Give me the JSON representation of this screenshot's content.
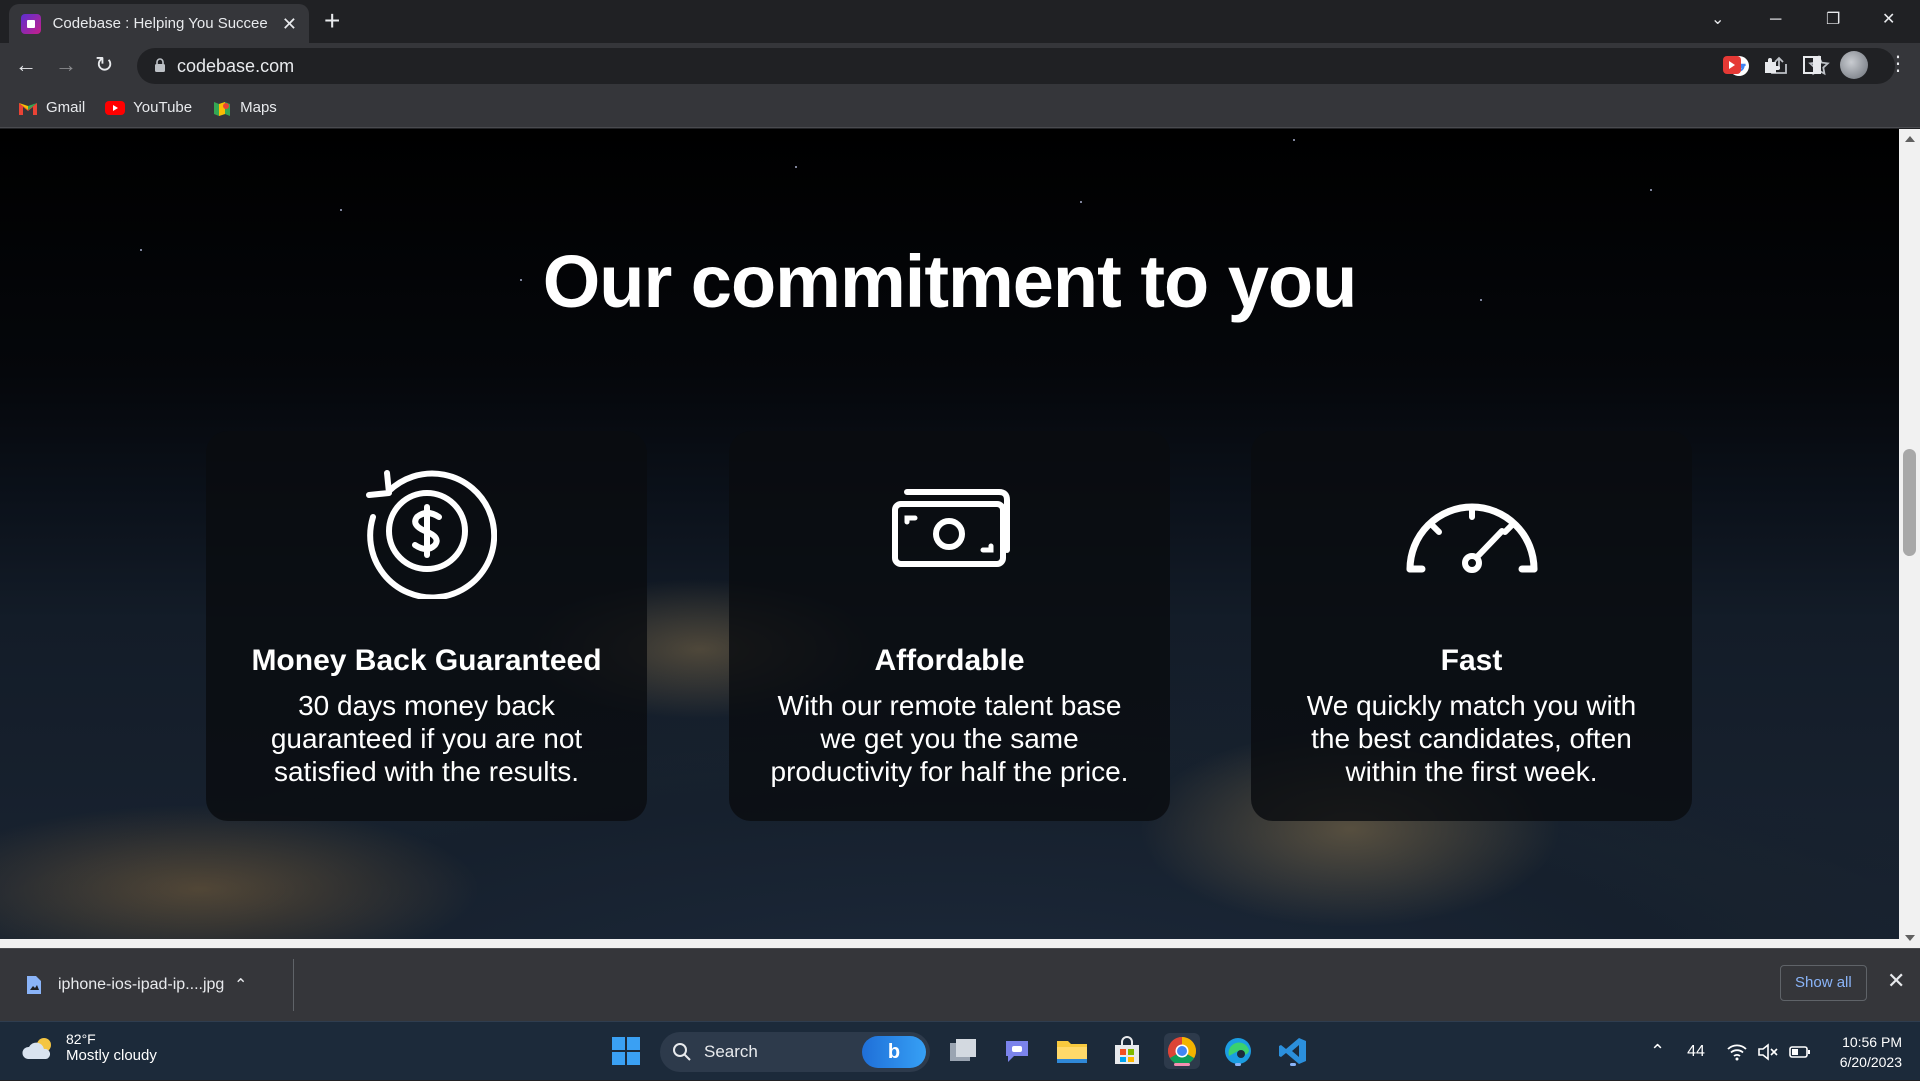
{
  "browser": {
    "tab_title": "Codebase : Helping You Succeed",
    "url": "codebase.com",
    "bookmarks": [
      {
        "label": "Gmail",
        "icon": "gmail-icon"
      },
      {
        "label": "YouTube",
        "icon": "youtube-icon"
      },
      {
        "label": "Maps",
        "icon": "maps-icon"
      }
    ]
  },
  "page": {
    "heading": "Our commitment to you",
    "cards": [
      {
        "icon": "money-back-icon",
        "title": "Money Back Guaranteed",
        "description": "30 days money back guaranteed if you are not satisfied with the results."
      },
      {
        "icon": "cash-icon",
        "title": "Affordable",
        "description": "With our remote talent base we get you the same productivity for half the price."
      },
      {
        "icon": "speedometer-icon",
        "title": "Fast",
        "description": "We quickly match you with the best candidates, often within the first week."
      }
    ]
  },
  "downloads": {
    "file_name": "iphone-ios-ipad-ip....jpg",
    "show_all": "Show all"
  },
  "taskbar": {
    "weather_temp": "82°F",
    "weather_desc": "Mostly cloudy",
    "search_label": "Search",
    "tray_number": "44",
    "time": "10:56 PM",
    "date": "6/20/2023"
  },
  "colors": {
    "accent_link": "#8ab4f8",
    "chrome_dark": "#202124",
    "chrome_toolbar": "#35363a"
  }
}
